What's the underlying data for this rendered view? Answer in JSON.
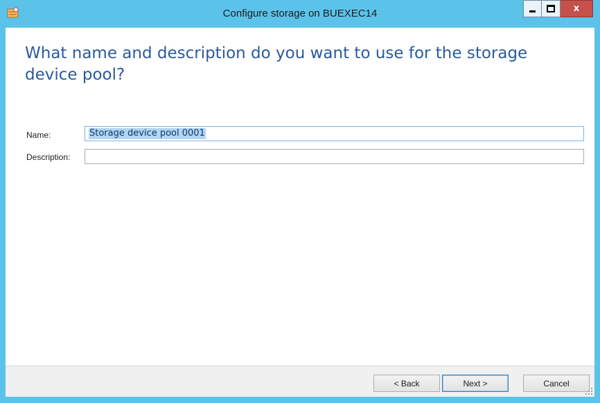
{
  "window": {
    "title": "Configure storage on BUEXEC14",
    "app_icon": "storage-wizard-icon",
    "controls": {
      "minimize": "minimize-icon",
      "maximize": "maximize-icon",
      "close_label": "x"
    }
  },
  "page": {
    "heading": "What name and description do you want to use for the storage device pool?"
  },
  "form": {
    "name_label": "Name:",
    "name_value": "Storage device pool 0001",
    "description_label": "Description:",
    "description_value": ""
  },
  "footer": {
    "back_label": "< Back",
    "next_label": "Next >",
    "cancel_label": "Cancel"
  },
  "colors": {
    "titlebar": "#5bc3ea",
    "heading": "#2a5b9c",
    "close_button": "#c7504a",
    "selection": "#b3d5f2"
  }
}
